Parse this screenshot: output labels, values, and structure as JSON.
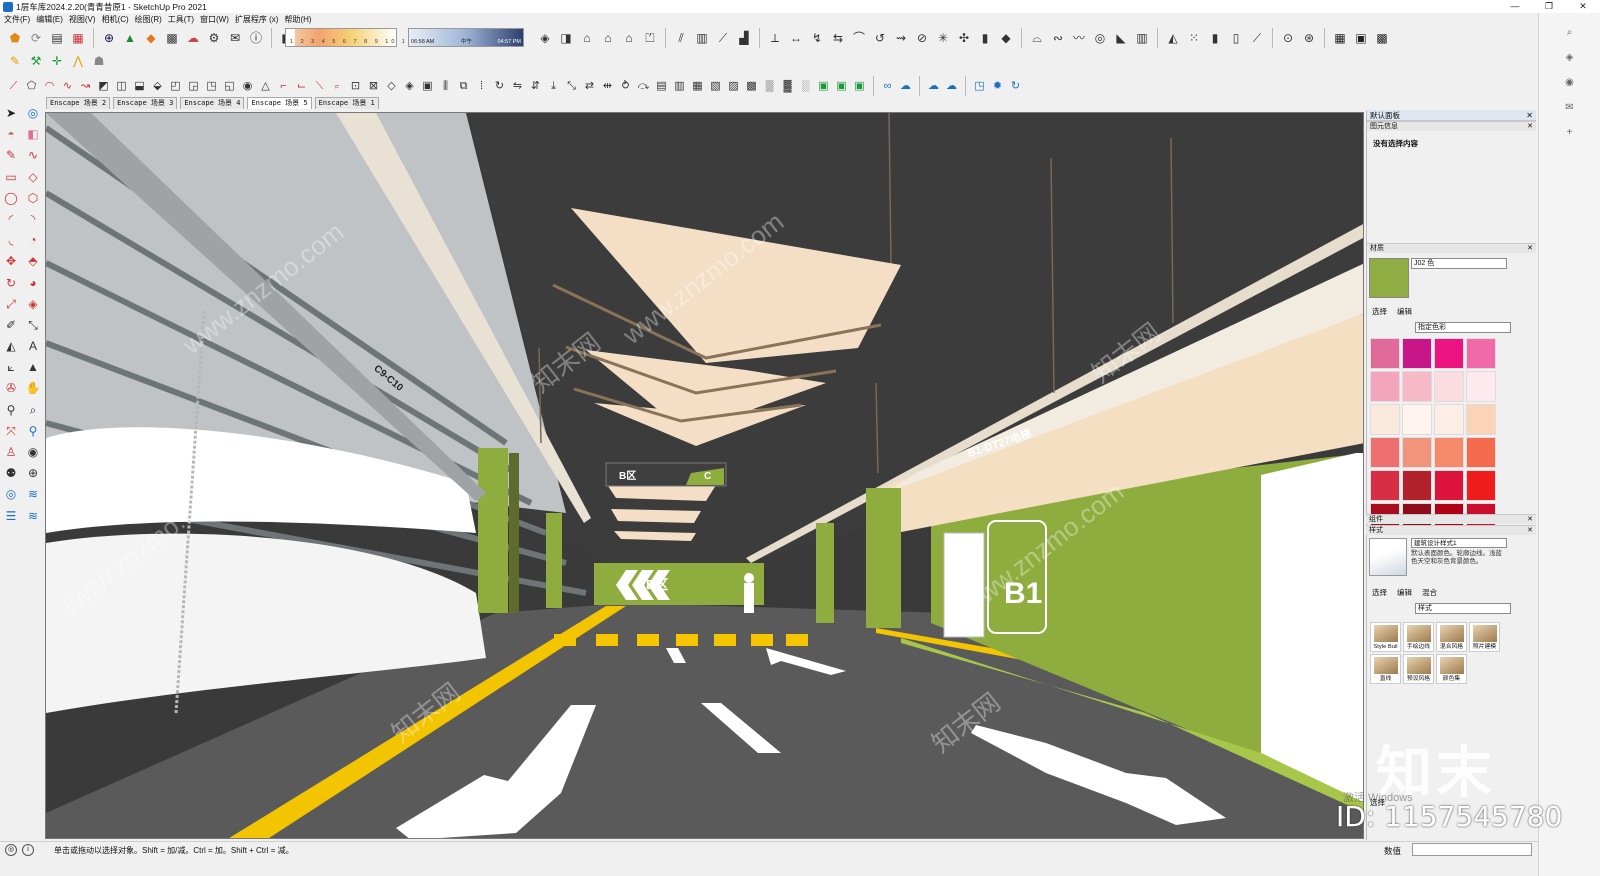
{
  "window": {
    "title": "1层车库2024.2.20(青青昔原1 - SketchUp Pro 2021",
    "controls": [
      "—",
      "❐",
      "✕"
    ]
  },
  "menu": [
    "文件(F)",
    "编辑(E)",
    "视图(V)",
    "相机(C)",
    "绘图(R)",
    "工具(T)",
    "窗口(W)",
    "扩展程序 (x)",
    "帮助(H)"
  ],
  "shadow": {
    "months": "1 2 3 4 5 6 7 8 9 10 11 12",
    "time_start": "06:58 AM",
    "time_mid": "中午",
    "time_end": "04:57 PM"
  },
  "scene_tabs": [
    "Enscape 场景 2",
    "Enscape 场景 3",
    "Enscape 场景 4",
    "Enscape 场景 5",
    "Enscape 场景 1"
  ],
  "active_tab_index": 3,
  "viewport": {
    "sign_b1_elevator": "B1-DT27电梯",
    "sign_zone_b_ceiling": "B区",
    "sign_c_ceiling": "C",
    "wall_zone_b": "B区",
    "wall_b1": "B1",
    "pillar_label": "C9-C10"
  },
  "tray": {
    "title": "默认面板",
    "entity_info": {
      "header": "图元信息",
      "text": "没有选择内容"
    },
    "materials": {
      "header": "材质",
      "name": "J02 色",
      "current_color": "#90ad44",
      "tabs": [
        "选择",
        "编辑"
      ],
      "collection": "指定色彩",
      "swatch_colors": [
        "#e06a9a",
        "#c7168a",
        "#ee1383",
        "#f06aa9",
        "#f5a4bd",
        "#f7b8c8",
        "#fbdde1",
        "#fdeaef",
        "#fbe8dc",
        "#fdf3ef",
        "#fcede6",
        "#fbd4b8",
        "#ee6f72",
        "#f0947c",
        "#f58a6b",
        "#f36b4c",
        "#d62f45",
        "#b3212d",
        "#dc143c",
        "#ef1c1c",
        "#a80d1d",
        "#8b0d1a",
        "#b00016",
        "#c8102e"
      ]
    },
    "components": {
      "header": "组件"
    },
    "styles": {
      "header": "样式",
      "name": "建筑设计样式1",
      "description": "默认表面颜色。轮廓边线。浅蓝色天空和灰色背景颜色。",
      "tabs": [
        "选择",
        "编辑",
        "混合"
      ],
      "collection": "样式",
      "items": [
        "Style Buil",
        "手绘边线",
        "混合风格",
        "照片建模",
        "直线",
        "预设风格",
        "颜色集"
      ]
    }
  },
  "watermarks": {
    "activate_windows": "激活 Windows",
    "select_label": "选择",
    "brand": "知末",
    "id": "ID: 1157545780",
    "site": "www.znzmo.com",
    "site_cn": "知末网"
  },
  "status": {
    "message": "单击或拖动以选择对象。Shift = 加/减。Ctrl = 加。Shift + Ctrl = 减。",
    "vcb_label": "数值"
  }
}
